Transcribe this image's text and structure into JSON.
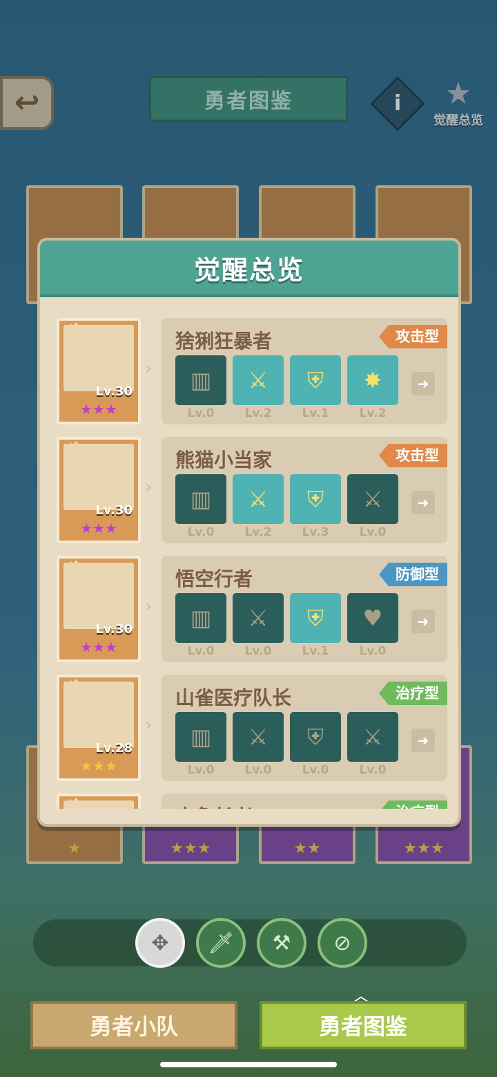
{
  "header": {
    "back_icon": "back-arrow-icon",
    "title": "勇者图鉴",
    "info_label": "i",
    "awaken_label": "觉醒总览"
  },
  "modal": {
    "title": "觉醒总览",
    "heroes": [
      {
        "name": "猞猁狂暴者",
        "level": "Lv.30",
        "stars": "★★★",
        "star_color": "#c23bd4",
        "type": "攻击型",
        "type_class": "attack",
        "skills": [
          {
            "icon": "pillar",
            "glyph": "▥",
            "on": false,
            "level": "Lv.0"
          },
          {
            "icon": "crossed-swords",
            "glyph": "⚔",
            "on": true,
            "level": "Lv.2"
          },
          {
            "icon": "shield",
            "glyph": "⛨",
            "on": true,
            "level": "Lv.1"
          },
          {
            "icon": "burst",
            "glyph": "✸",
            "on": true,
            "level": "Lv.2"
          }
        ]
      },
      {
        "name": "熊猫小当家",
        "level": "Lv.30",
        "stars": "★★★",
        "star_color": "#c23bd4",
        "type": "攻击型",
        "type_class": "attack",
        "skills": [
          {
            "icon": "pillar",
            "glyph": "▥",
            "on": false,
            "level": "Lv.0"
          },
          {
            "icon": "crossed-swords",
            "glyph": "⚔",
            "on": true,
            "level": "Lv.2"
          },
          {
            "icon": "shield",
            "glyph": "⛨",
            "on": true,
            "level": "Lv.3"
          },
          {
            "icon": "crossed-swords",
            "glyph": "⚔",
            "on": false,
            "level": "Lv.0"
          }
        ]
      },
      {
        "name": "悟空行者",
        "level": "Lv.30",
        "stars": "★★★",
        "star_color": "#c23bd4",
        "type": "防御型",
        "type_class": "defense",
        "skills": [
          {
            "icon": "pillar",
            "glyph": "▥",
            "on": false,
            "level": "Lv.0"
          },
          {
            "icon": "crossed-swords",
            "glyph": "⚔",
            "on": false,
            "level": "Lv.0"
          },
          {
            "icon": "shield",
            "glyph": "⛨",
            "on": true,
            "level": "Lv.1"
          },
          {
            "icon": "heart-plus",
            "glyph": "♥",
            "on": false,
            "level": "Lv.0"
          }
        ]
      },
      {
        "name": "山雀医疗队长",
        "level": "Lv.28",
        "stars": "★★★",
        "star_color": "#f0c93a",
        "type": "治疗型",
        "type_class": "heal",
        "skills": [
          {
            "icon": "pillar",
            "glyph": "▥",
            "on": false,
            "level": "Lv.0"
          },
          {
            "icon": "crossed-swords",
            "glyph": "⚔",
            "on": false,
            "level": "Lv.0"
          },
          {
            "icon": "shield",
            "glyph": "⛨",
            "on": false,
            "level": "Lv.0"
          },
          {
            "icon": "crossed-swords",
            "glyph": "⚔",
            "on": false,
            "level": "Lv.0"
          }
        ]
      },
      {
        "name": "大象长者",
        "level": "",
        "stars": "",
        "star_color": "#f0c93a",
        "type": "治疗型",
        "type_class": "heal",
        "skills": []
      }
    ]
  },
  "filters": [
    {
      "name": "all",
      "glyph": "✥"
    },
    {
      "name": "attack",
      "glyph": "🗡"
    },
    {
      "name": "hammer",
      "glyph": "⚒"
    },
    {
      "name": "compass",
      "glyph": "⊘"
    }
  ],
  "tabs": {
    "left": "勇者小队",
    "right": "勇者图鉴"
  }
}
